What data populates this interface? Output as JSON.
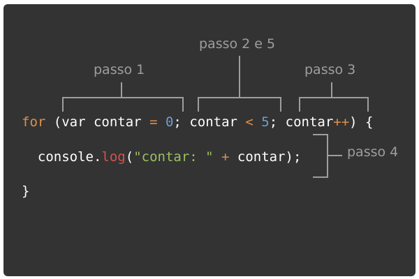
{
  "colors": {
    "background": "#333333",
    "text": "#ffffff",
    "annotation": "#9e9e9e",
    "keyword": "#e0904a",
    "number": "#6f9fd0",
    "operator": "#e0904a",
    "function": "#d65050",
    "string": "#9bc063"
  },
  "annotations": {
    "step1": "passo 1",
    "step25": "passo 2 e 5",
    "step3": "passo 3",
    "step4": "passo 4"
  },
  "code": {
    "line1": {
      "kw_for": "for",
      "open_paren": " (",
      "kw_var": "var",
      "var_init": " contar ",
      "op_assign": "=",
      "sp1": " ",
      "num_zero": "0",
      "semi1": "; ",
      "var_cond": "contar ",
      "op_lt": "<",
      "sp2": " ",
      "num_five": "5",
      "semi2": "; ",
      "var_inc": "contar",
      "op_inc": "++",
      "close": ") {"
    },
    "line2": {
      "indent": "  ",
      "obj": "console.",
      "fn": "log",
      "paren_open": "(",
      "str": "\"contar: \"",
      "sp": " ",
      "op_plus": "+",
      "rest": " contar);"
    },
    "line3": {
      "brace": "}"
    }
  }
}
